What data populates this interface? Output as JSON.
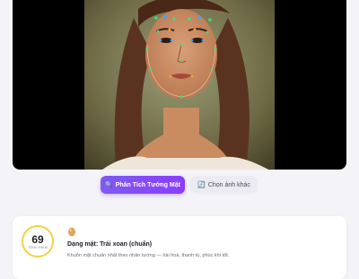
{
  "toolbar": {
    "analyze_label": "Phân Tích Tướng Mặt",
    "analyze_icon": "sparkle-search-icon",
    "choose_label": "Chọn ảnh khác",
    "choose_icon": "refresh-image-icon"
  },
  "result": {
    "score": "69",
    "score_label": "TỔNG ĐIỂM",
    "shape_icon": "egg-icon",
    "shape_title": "Dạng mặt: Trái xoan (chuẩn)",
    "shape_desc": "Khuôn mặt chuẩn nhất theo nhân tướng — hài hoà, thanh tú, phúc khí tốt."
  },
  "colors": {
    "accent": "#8b3dff",
    "score_ring": "#f2d14a",
    "landmark_green": "#3ddc84",
    "landmark_blue": "#3ba7ff",
    "landmark_orange": "#ff9f3d"
  }
}
